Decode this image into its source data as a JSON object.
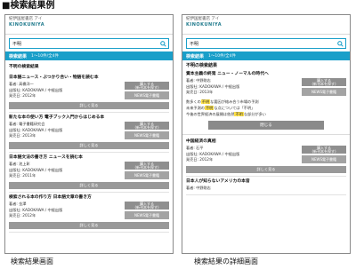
{
  "heading": "■検索結果例",
  "logo": {
    "line1": "紀伊国屋書店 アイ",
    "line2": "KINOKUNIYA"
  },
  "search": {
    "query": "不明"
  },
  "left": {
    "result_label": "検索結果",
    "result_sub": "1〜10件/全4件",
    "list_title": "不明の検索結果",
    "items": [
      {
        "title": "日本語ニュース・ぶつかり合い・物語を読む本",
        "author": "著者: 高橋洋一",
        "publisher": "出版社: KADOKAWA / 中経出版",
        "date": "発売日: 2012年",
        "btn1": "購入する\n(新刊本を探す)",
        "btn2": "NEWS電子書籍",
        "detail": "詳しく見る"
      },
      {
        "title": "新たな本の使い方 電子ブック入門からはじめる本",
        "author": "著者: 電子書籍研究会",
        "publisher": "出版社: KADOKAWA / 中経出版",
        "date": "発売日: 2013年",
        "btn1": "購入する\n(新刊本を探す)",
        "btn2": "NEWS電子書籍",
        "detail": "詳しく見る"
      },
      {
        "title": "日本語文法の書き方 ニュースを読む本",
        "author": "著者: 池上彰",
        "publisher": "出版社: KADOKAWA / 中経出版",
        "date": "発売日: 2011年",
        "btn1": "購入する\n(新刊本を探す)",
        "btn2": "NEWS電子書籍",
        "detail": "詳しく見る"
      },
      {
        "title": "検索される本の作り方 日本語文章の書き方",
        "author": "著者: 金澤",
        "publisher": "出版社: KADOKAWA / 中経出版",
        "date": "発売日: 2012年",
        "btn1": "購入する\n(新刊本を探す)",
        "btn2": "NEWS電子書籍",
        "detail": "詳しく見る"
      }
    ]
  },
  "right": {
    "result_label": "検索結果",
    "result_sub": "1〜10件/全4件",
    "list_title": "不明の検索結果",
    "item1": {
      "title": "資本主義の終焉 ニュー・ノーマルの時代へ",
      "author": "著者: 中野剛志",
      "publisher": "出版社: KADOKAWA / 中経出版",
      "date": "発売日: 2013年",
      "btn1": "購入する\n(新刊本を探す)",
      "btn2": "NEWS電子書籍"
    },
    "snippets": [
      {
        "pre": "数多くの",
        "hl": "不明",
        "post": "な要因が絡み合う市場の予測"
      },
      {
        "pre": "未来予測の",
        "hl": "不明",
        "post": "な点については「不明」"
      },
      {
        "pre": "今後の世界経済の展開は依然",
        "hl": "不明",
        "post": "な部分が多い"
      }
    ],
    "close_label": "閉じる",
    "item2": {
      "title": "中国経済の真相",
      "author": "著者: 石平",
      "publisher": "出版社: KADOKAWA / 中経出版",
      "date": "発売日: 2012年",
      "btn1": "購入する\n(新刊本を探す)",
      "btn2": "NEWS電子書籍",
      "detail": "詳しく見る"
    },
    "item3": {
      "title": "日本人が知らないアメリカの本音",
      "author": "著者: 中野剛志"
    }
  },
  "captions": {
    "left": "検索結果画面",
    "right": "検索結果の詳細画面"
  }
}
